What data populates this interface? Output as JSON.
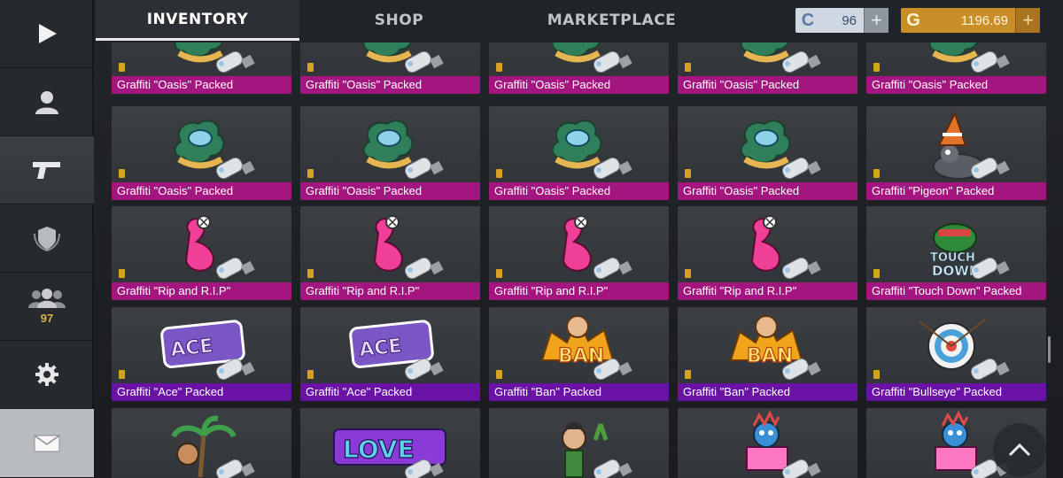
{
  "tabs": [
    {
      "label": "INVENTORY",
      "active": true
    },
    {
      "label": "SHOP",
      "active": false
    },
    {
      "label": "MARKETPLACE",
      "active": false
    }
  ],
  "currencies": {
    "silver": {
      "symbol": "C",
      "value": "96",
      "color": "#6d8cb0"
    },
    "gold": {
      "symbol": "G",
      "value": "1196.69",
      "color": "#d19a2c"
    }
  },
  "sidebar": {
    "items": [
      {
        "icon": "play-icon"
      },
      {
        "icon": "user-icon"
      },
      {
        "icon": "pistol-icon"
      },
      {
        "icon": "rank-badge-icon"
      },
      {
        "icon": "friends-icon",
        "count": "97"
      },
      {
        "icon": "gear-icon"
      },
      {
        "icon": "mail-icon"
      }
    ]
  },
  "colors": {
    "label_pink": "#a3157f",
    "label_purple": "#6a11a6"
  },
  "items": [
    {
      "name": "Graffiti \"Oasis\" Packed",
      "art": "oasis",
      "label": "pink"
    },
    {
      "name": "Graffiti \"Oasis\" Packed",
      "art": "oasis",
      "label": "pink"
    },
    {
      "name": "Graffiti \"Oasis\" Packed",
      "art": "oasis",
      "label": "pink"
    },
    {
      "name": "Graffiti \"Oasis\" Packed",
      "art": "oasis",
      "label": "pink"
    },
    {
      "name": "Graffiti \"Oasis\" Packed",
      "art": "oasis",
      "label": "pink"
    },
    {
      "name": "Graffiti \"Oasis\" Packed",
      "art": "oasis",
      "label": "pink"
    },
    {
      "name": "Graffiti \"Oasis\" Packed",
      "art": "oasis",
      "label": "pink"
    },
    {
      "name": "Graffiti \"Oasis\" Packed",
      "art": "oasis",
      "label": "pink"
    },
    {
      "name": "Graffiti \"Oasis\" Packed",
      "art": "oasis",
      "label": "pink"
    },
    {
      "name": "Graffiti \"Pigeon\" Packed",
      "art": "pigeon",
      "label": "pink"
    },
    {
      "name": "Graffiti \"Rip and R.I.P\"",
      "art": "flamingo",
      "label": "pink"
    },
    {
      "name": "Graffiti \"Rip and R.I.P\"",
      "art": "flamingo",
      "label": "pink"
    },
    {
      "name": "Graffiti \"Rip and R.I.P\"",
      "art": "flamingo",
      "label": "pink"
    },
    {
      "name": "Graffiti \"Rip and R.I.P\"",
      "art": "flamingo",
      "label": "pink"
    },
    {
      "name": "Graffiti \"Touch Down\" Packed",
      "art": "touchdown",
      "label": "pink"
    },
    {
      "name": "Graffiti \"Ace\" Packed",
      "art": "ace",
      "label": "purple"
    },
    {
      "name": "Graffiti \"Ace\" Packed",
      "art": "ace",
      "label": "purple"
    },
    {
      "name": "Graffiti \"Ban\" Packed",
      "art": "ban",
      "label": "purple"
    },
    {
      "name": "Graffiti \"Ban\" Packed",
      "art": "ban",
      "label": "purple"
    },
    {
      "name": "Graffiti \"Bullseye\" Packed",
      "art": "bullseye",
      "label": "purple"
    },
    {
      "name": "",
      "art": "palm",
      "label": "none"
    },
    {
      "name": "",
      "art": "love",
      "label": "none"
    },
    {
      "name": "",
      "art": "cactus",
      "label": "none"
    },
    {
      "name": "",
      "art": "cake",
      "label": "none"
    },
    {
      "name": "",
      "art": "cake",
      "label": "none"
    }
  ]
}
